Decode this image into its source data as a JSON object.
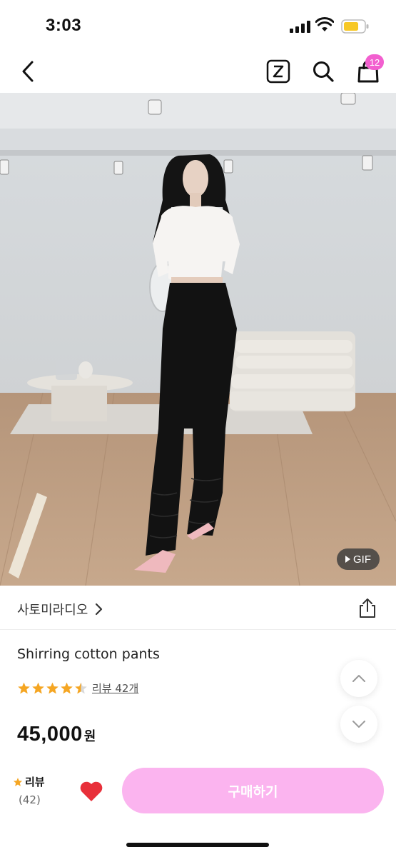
{
  "status_bar": {
    "time": "3:03"
  },
  "nav": {
    "cart_count": "12"
  },
  "colors": {
    "accent": "#f25fcf",
    "buy_button": "#fbb4ef",
    "star": "#f5a623",
    "heart": "#e8303a"
  },
  "icons": [
    "back-icon",
    "z-icon",
    "search-icon",
    "cart-icon",
    "share-icon",
    "chevron-right-icon",
    "chevron-up-icon",
    "chevron-down-icon",
    "star-icon",
    "heart-icon",
    "play-icon"
  ],
  "hero": {
    "gif_label": "GIF"
  },
  "shop": {
    "name": "사토미라디오"
  },
  "product": {
    "name": "Shirring cotton pants",
    "rating": 4.5,
    "review_link": "리뷰 42개",
    "price": "45,000",
    "currency": "원"
  },
  "bottom": {
    "review_label": "리뷰",
    "review_count": "(42)",
    "buy_label": "구매하기"
  }
}
